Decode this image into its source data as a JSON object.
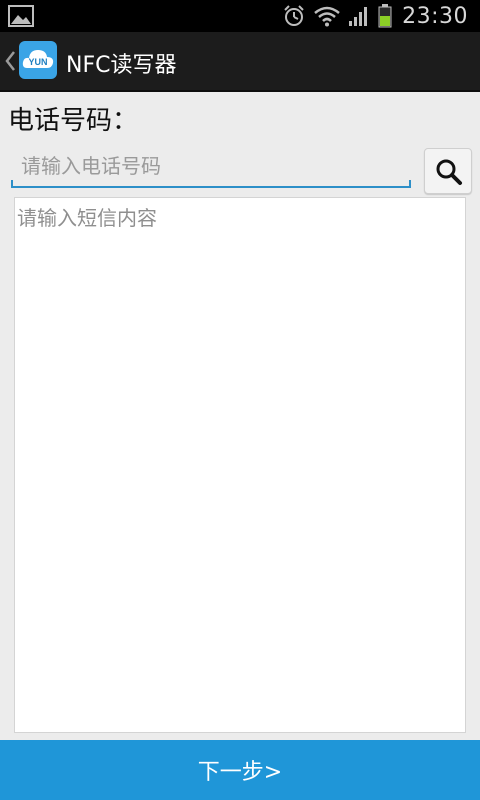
{
  "status_bar": {
    "time": "23:30",
    "icons": [
      "gallery-notification-icon",
      "alarm-icon",
      "wifi-icon",
      "signal-icon",
      "battery-icon"
    ]
  },
  "action_bar": {
    "title": "NFC读写器",
    "logo_text": "YUN",
    "logo_color": "#3aa4e6"
  },
  "form": {
    "phone_label": "电话号码：",
    "phone_placeholder": "请输入电话号码",
    "sms_placeholder": "请输入短信内容"
  },
  "footer": {
    "next_label": "下一步>",
    "accent_color": "#1f96d8"
  }
}
